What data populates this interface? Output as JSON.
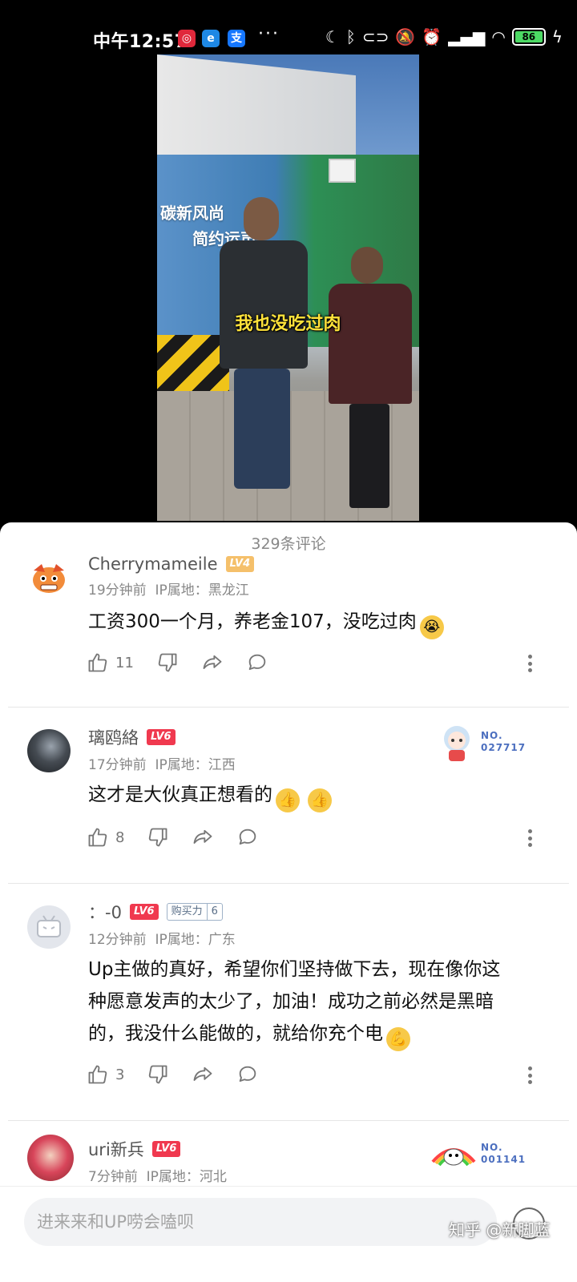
{
  "status_bar": {
    "time": "中午12:57",
    "battery": "86",
    "overflow": "···"
  },
  "video": {
    "subtitle": "我也没吃过肉",
    "hoarding_line1": "碳新风尚",
    "hoarding_line2": "简约运声"
  },
  "comments_count": "329条评论",
  "comments": [
    {
      "username": "Cherrymameile",
      "level": "LV4",
      "time": "19分钟前",
      "ip": "IP属地：黑龙江",
      "text": "工资300一个月，养老金107，没吃过肉",
      "likes": "11"
    },
    {
      "username": "璃鸥絡",
      "level": "LV6",
      "time": "17分钟前",
      "ip": "IP属地：江西",
      "text": "这才是大伙真正想看的",
      "likes": "8",
      "badge_no": "NO.",
      "badge_num": "027717"
    },
    {
      "username": "：-0",
      "level": "LV6",
      "buy_label": "购买力",
      "buy_value": "6",
      "time": "12分钟前",
      "ip": "IP属地：广东",
      "text_lines": [
        "Up主做的真好，希望你们坚持做下去，现在像你这",
        "种愿意发声的太少了，加油！成功之前必然是黑暗",
        "的，我没什么能做的，就给你充个电"
      ],
      "likes": "3"
    },
    {
      "username": "uri新兵",
      "level": "LV6",
      "time": "7分钟前",
      "ip": "IP属地：河北",
      "badge_no": "NO.",
      "badge_num": "001141"
    }
  ],
  "input_placeholder": "进来来和UP唠会嗑呗",
  "watermark": "知乎 @新脚蓝",
  "colors": {
    "level6": "#f0394f",
    "level4": "#f5c06b",
    "subtitle": "#ffe23a"
  }
}
